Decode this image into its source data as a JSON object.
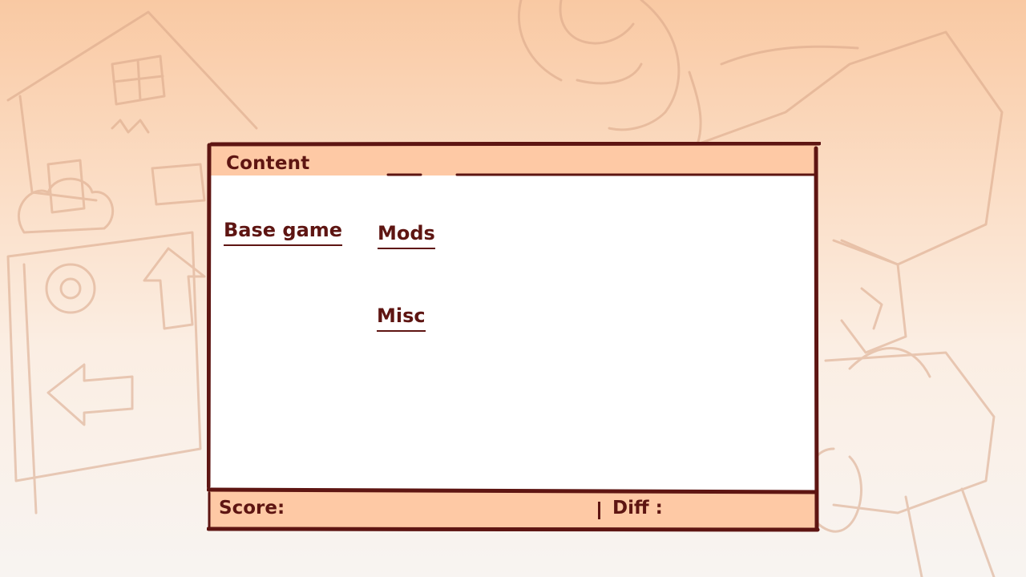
{
  "window": {
    "title": "Content"
  },
  "categories": [
    {
      "label": "Base game"
    },
    {
      "label": "Mods"
    },
    {
      "label": "Misc"
    }
  ],
  "footer": {
    "score_label": "Score:",
    "diff_label": "Diff :"
  },
  "colors": {
    "accent_dark": "#5e1512",
    "panel_header": "#fec9a5",
    "background_top": "#f9c9a3",
    "background_bottom": "#f8f4f1"
  }
}
